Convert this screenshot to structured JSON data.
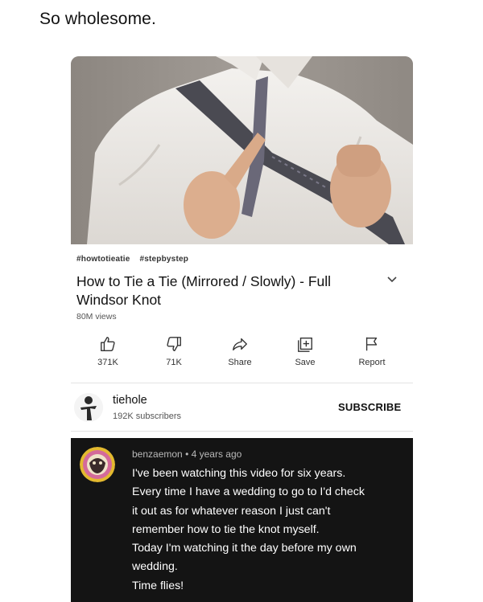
{
  "post": {
    "caption": "So wholesome."
  },
  "video": {
    "hashtags": [
      "#howtotieatie",
      "#stepbystep"
    ],
    "title": "How to Tie a Tie (Mirrored / Slowly) - Full Windsor Knot",
    "views": "80M views"
  },
  "actions": [
    {
      "icon": "thumbs-up-icon",
      "label": "371K"
    },
    {
      "icon": "thumbs-down-icon",
      "label": "71K"
    },
    {
      "icon": "share-icon",
      "label": "Share"
    },
    {
      "icon": "save-playlist-icon",
      "label": "Save"
    },
    {
      "icon": "flag-icon",
      "label": "Report"
    }
  ],
  "channel": {
    "name": "tiehole",
    "subscribers": "192K subscribers",
    "subscribe_label": "SUBSCRIBE"
  },
  "comment": {
    "author": "benzaemon",
    "separator": "•",
    "age": "4 years ago",
    "lines": [
      "I've been watching this video for six years.",
      "Every time I have a wedding to go to I'd check",
      "it out as for whatever reason I just can't",
      "remember how to tie the knot myself.",
      "Today I'm watching it the day before my own",
      "wedding.",
      "Time flies!"
    ]
  },
  "colors": {
    "comment_background": "#141414",
    "subscribe_text": "#111111"
  }
}
